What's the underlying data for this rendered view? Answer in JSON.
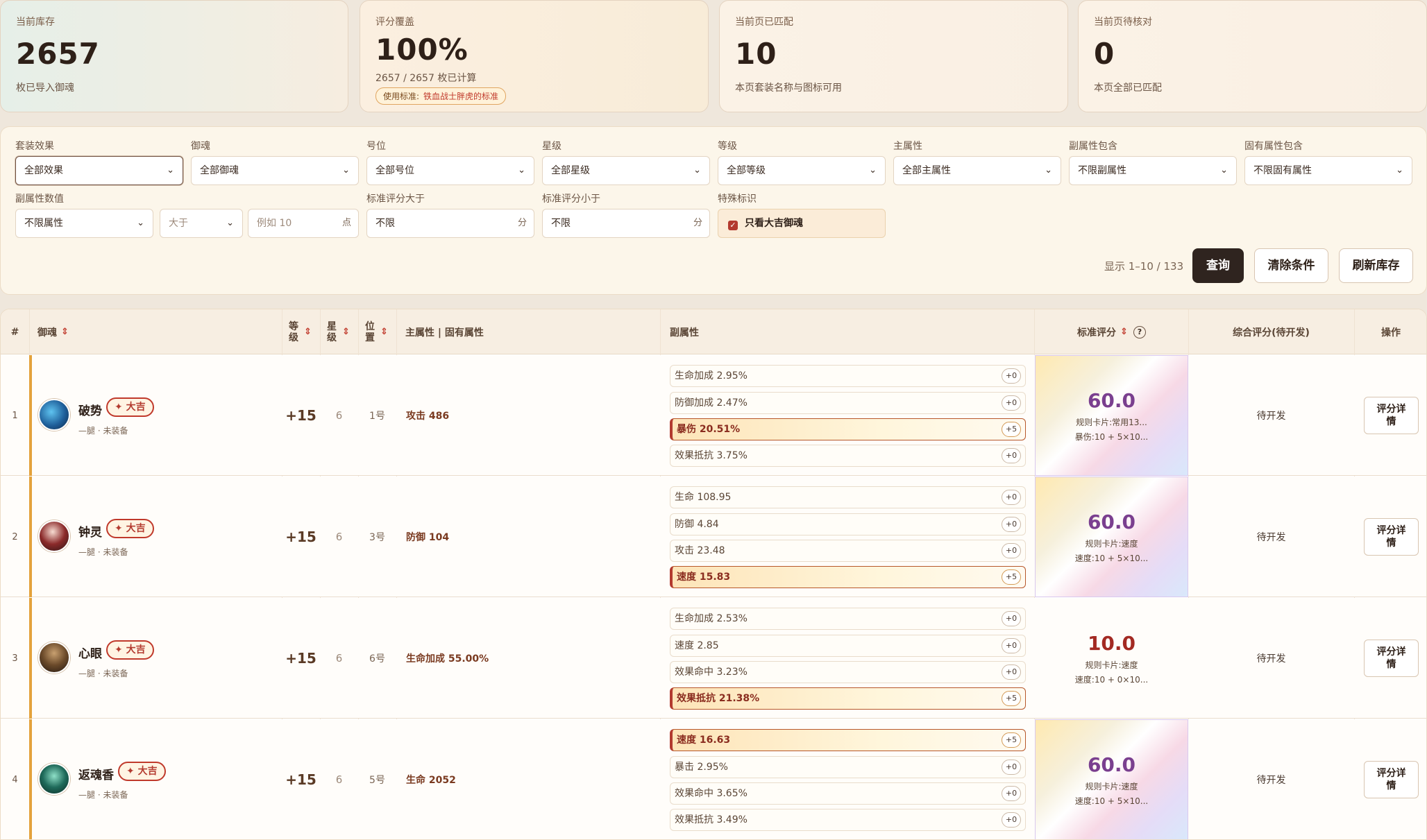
{
  "stats": [
    {
      "label": "当前库存",
      "value": "2657",
      "sub": "枚已导入御魂"
    },
    {
      "label": "评分覆盖",
      "value": "100%",
      "sub": "2657 / 2657 枚已计算",
      "pill_label": "使用标准:",
      "pill_value": "铁血战士胖虎的标准"
    },
    {
      "label": "当前页已匹配",
      "value": "10",
      "sub": "本页套装名称与图标可用"
    },
    {
      "label": "当前页待核对",
      "value": "0",
      "sub": "本页全部已匹配"
    }
  ],
  "filters": {
    "set_effect": {
      "label": "套装效果",
      "value": "全部效果"
    },
    "yuhun": {
      "label": "御魂",
      "value": "全部御魂"
    },
    "slot": {
      "label": "号位",
      "value": "全部号位"
    },
    "star": {
      "label": "星级",
      "value": "全部星级"
    },
    "level": {
      "label": "等级",
      "value": "全部等级"
    },
    "main_attr": {
      "label": "主属性",
      "value": "全部主属性"
    },
    "sub_contains": {
      "label": "副属性包含",
      "value": "不限副属性"
    },
    "fixed_contains": {
      "label": "固有属性包含",
      "value": "不限固有属性"
    },
    "sub_value": {
      "label": "副属性数值",
      "attr": "不限属性",
      "op": "大于",
      "placeholder": "例如 10",
      "unit": "点"
    },
    "score_gt": {
      "label": "标准评分大于",
      "value": "不限",
      "unit": "分"
    },
    "score_lt": {
      "label": "标准评分小于",
      "value": "不限",
      "unit": "分"
    },
    "special": {
      "label": "特殊标识",
      "checkbox": "只看大吉御魂",
      "checked": true
    }
  },
  "range_text": "显示 1–10 / 133",
  "buttons": {
    "query": "查询",
    "clear": "清除条件",
    "refresh": "刷新库存"
  },
  "table": {
    "headers": {
      "idx": "#",
      "yuhun": "御魂",
      "level": "等级",
      "star": "星级",
      "pos": "位置",
      "main": "主属性 | 固有属性",
      "sub": "副属性",
      "score": "标准评分",
      "combined": "综合评分(待开发)",
      "action": "操作"
    },
    "rows": [
      {
        "idx": "1",
        "name": "破势",
        "tag": "✦ 大吉",
        "sub": "—腿 · 未装备",
        "level": "+15",
        "star": "6",
        "pos": "1号",
        "main": "攻击 486",
        "subs": [
          {
            "text": "生命加成 2.95%",
            "badge": "+0",
            "hit": false
          },
          {
            "text": "防御加成 2.47%",
            "badge": "+0",
            "hit": false
          },
          {
            "text": "暴伤 20.51%",
            "badge": "+5",
            "hit": true
          },
          {
            "text": "效果抵抗 3.75%",
            "badge": "+0",
            "hit": false
          }
        ],
        "score": "60.0",
        "rule": "规则卡片:常用13...",
        "rule2": "暴伤:10 + 5×10...",
        "holo": true,
        "combined": "待开发",
        "action": "评分详情"
      },
      {
        "idx": "2",
        "name": "钟灵",
        "tag": "✦ 大吉",
        "sub": "—腿 · 未装备",
        "level": "+15",
        "star": "6",
        "pos": "3号",
        "main": "防御 104",
        "subs": [
          {
            "text": "生命 108.95",
            "badge": "+0",
            "hit": false
          },
          {
            "text": "防御 4.84",
            "badge": "+0",
            "hit": false
          },
          {
            "text": "攻击 23.48",
            "badge": "+0",
            "hit": false
          },
          {
            "text": "速度 15.83",
            "badge": "+5",
            "hit": true
          }
        ],
        "score": "60.0",
        "rule": "规则卡片:速度",
        "rule2": "速度:10 + 5×10...",
        "holo": true,
        "combined": "待开发",
        "action": "评分详情"
      },
      {
        "idx": "3",
        "name": "心眼",
        "tag": "✦ 大吉",
        "sub": "—腿 · 未装备",
        "level": "+15",
        "star": "6",
        "pos": "6号",
        "main": "生命加成 55.00%",
        "subs": [
          {
            "text": "生命加成 2.53%",
            "badge": "+0",
            "hit": false
          },
          {
            "text": "速度 2.85",
            "badge": "+0",
            "hit": false
          },
          {
            "text": "效果命中 3.23%",
            "badge": "+0",
            "hit": false
          },
          {
            "text": "效果抵抗 21.38%",
            "badge": "+5",
            "hit": true
          }
        ],
        "score": "10.0",
        "rule": "规则卡片:速度",
        "rule2": "速度:10 + 0×10...",
        "holo": false,
        "combined": "待开发",
        "action": "评分详情"
      },
      {
        "idx": "4",
        "name": "返魂香",
        "tag": "✦ 大吉",
        "sub": "—腿 · 未装备",
        "level": "+15",
        "star": "6",
        "pos": "5号",
        "main": "生命 2052",
        "subs": [
          {
            "text": "速度 16.63",
            "badge": "+5",
            "hit": true
          },
          {
            "text": "暴击 2.95%",
            "badge": "+0",
            "hit": false
          },
          {
            "text": "效果命中 3.65%",
            "badge": "+0",
            "hit": false
          },
          {
            "text": "效果抵抗 3.49%",
            "badge": "+0",
            "hit": false
          }
        ],
        "score": "60.0",
        "rule": "规则卡片:速度",
        "rule2": "速度:10 + 5×10...",
        "holo": true,
        "combined": "待开发",
        "action": "评分详情"
      }
    ]
  }
}
